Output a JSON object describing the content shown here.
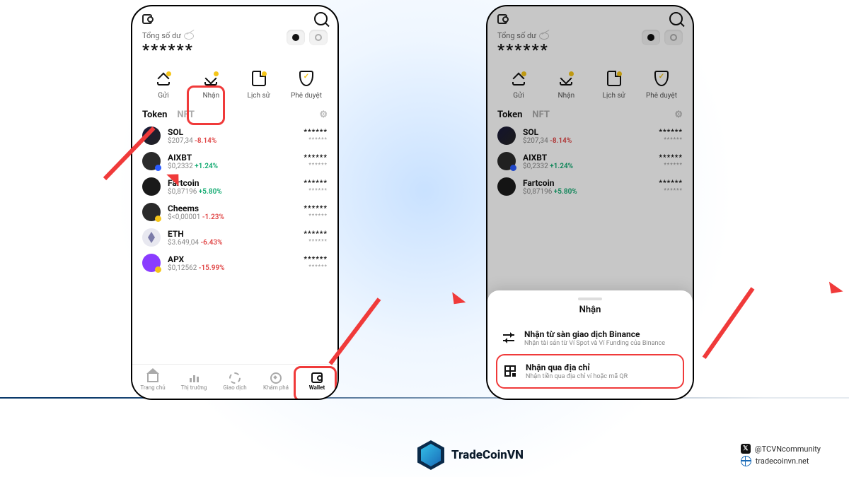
{
  "balance_label": "Tổng số dư",
  "balance_value": "******",
  "actions": {
    "send": "Gửi",
    "receive": "Nhận",
    "history": "Lịch sử",
    "approve": "Phê duyệt"
  },
  "tabs": {
    "token": "Token",
    "nft": "NFT"
  },
  "mask": "******",
  "tokens": [
    {
      "sym": "SOL",
      "price": "$207,34",
      "chg": "-8.14%",
      "dir": "neg",
      "ico": "sol"
    },
    {
      "sym": "AIXBT",
      "price": "$0,2332",
      "chg": "+1.24%",
      "dir": "pos",
      "ico": "aix"
    },
    {
      "sym": "Fartcoin",
      "price": "$0,87196",
      "chg": "+5.80%",
      "dir": "pos",
      "ico": "fart"
    },
    {
      "sym": "Cheems",
      "price": "$<0,00001",
      "chg": "-1.23%",
      "dir": "neg",
      "ico": "cheems"
    },
    {
      "sym": "ETH",
      "price": "$3.649,04",
      "chg": "-6.43%",
      "dir": "neg",
      "ico": "eth"
    },
    {
      "sym": "APX",
      "price": "$0,12562",
      "chg": "-15.99%",
      "dir": "neg",
      "ico": "apx"
    }
  ],
  "nav": {
    "home": "Trang chủ",
    "market": "Thị trường",
    "trade": "Giao dịch",
    "discover": "Khám phá",
    "wallet": "Wallet"
  },
  "sheet": {
    "title": "Nhận",
    "opt1": {
      "title": "Nhận từ sàn giao dịch Binance",
      "sub": "Nhận tài sản từ Ví Spot và Ví Funding của Binance"
    },
    "opt2": {
      "title": "Nhận qua địa chỉ",
      "sub": "Nhận tiền qua địa chỉ ví hoặc mã QR"
    }
  },
  "brand": "TradeCoinVN",
  "social": {
    "x": "@TCVNcommunity",
    "web": "tradecoinvn.net"
  }
}
